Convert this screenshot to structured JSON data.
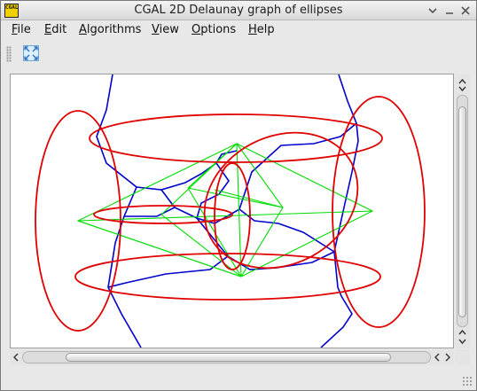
{
  "window": {
    "title": "CGAL 2D Delaunay graph of ellipses",
    "icon_text": "CGAL",
    "buttons": [
      "menu-arrow-icon",
      "minimize-icon",
      "close-icon"
    ]
  },
  "menubar": {
    "items": [
      {
        "label": "File",
        "mnemonic": "F"
      },
      {
        "label": "Edit",
        "mnemonic": "E"
      },
      {
        "label": "Algorithms",
        "mnemonic": "A"
      },
      {
        "label": "View",
        "mnemonic": "V"
      },
      {
        "label": "Options",
        "mnemonic": "O"
      },
      {
        "label": "Help",
        "mnemonic": "H"
      }
    ]
  },
  "toolbar": {
    "fit_button_icon": "fit-to-view-icon"
  },
  "scene": {
    "colors": {
      "ellipses": "#e00000",
      "voronoi_edges": "#0000cc",
      "delaunay_edges": "#00dd00",
      "background": "#ffffff"
    },
    "ellipse_count": 8
  },
  "scrollbars": {
    "vertical": {
      "position": 0.45
    },
    "horizontal": {
      "position": 0.45
    }
  }
}
